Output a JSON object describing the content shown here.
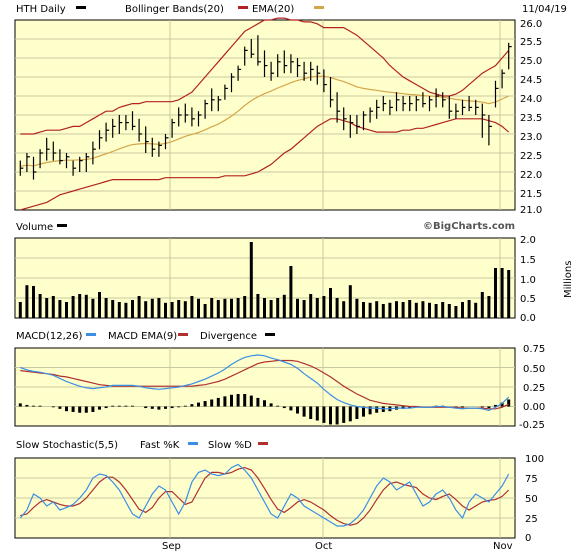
{
  "colors": {
    "panel_bg": "#ffffcc",
    "price_bar": "#000000",
    "bollinger": "#b22222",
    "ema": "#d4a64a",
    "volume_bar": "#000000",
    "macd": "#3a8ee6",
    "macd_ema": "#b03030",
    "fast_k": "#3a8ee6",
    "slow_d": "#b03030"
  },
  "header": {
    "ticker_label": "HTH Daily",
    "bb_label": "Bollinger Bands(20)",
    "ema_label": "EMA(20)",
    "date": "11/04/19"
  },
  "watermark": "©BigCharts.com",
  "chart_data": [
    {
      "type": "ohlc",
      "title": "HTH Daily",
      "legend": [
        "HTH Daily",
        "Bollinger Bands(20)",
        "EMA(20)"
      ],
      "x_tick_labels": [
        "Sep",
        "Oct",
        "Nov"
      ],
      "ylim": [
        21.0,
        26.0
      ],
      "y_ticks": [
        "21.0",
        "21.5",
        "22.0",
        "22.5",
        "23.0",
        "23.5",
        "24.0",
        "24.5",
        "25.0",
        "25.5",
        "26.0"
      ],
      "grid": true,
      "series": [
        {
          "name": "HTH Daily",
          "highs": [
            22.3,
            22.5,
            22.4,
            22.6,
            22.9,
            22.8,
            22.6,
            22.5,
            22.3,
            22.4,
            22.5,
            22.8,
            23.1,
            23.3,
            23.4,
            23.5,
            23.5,
            23.6,
            23.4,
            23.2,
            22.9,
            22.8,
            23.0,
            23.4,
            23.7,
            23.8,
            23.7,
            23.6,
            23.9,
            24.2,
            24.0,
            24.3,
            24.6,
            24.8,
            25.3,
            25.5,
            25.6,
            25.2,
            24.9,
            25.1,
            25.2,
            25.1,
            25.0,
            24.9,
            24.9,
            24.8,
            24.7,
            24.5,
            24.1,
            23.7,
            23.5,
            23.5,
            23.6,
            23.7,
            23.9,
            24.0,
            23.9,
            24.1,
            24.0,
            24.0,
            24.0,
            24.1,
            24.0,
            24.2,
            24.1,
            24.0,
            23.8,
            23.9,
            24.0,
            23.9,
            23.8,
            23.5,
            24.4,
            24.7,
            25.4
          ],
          "lows": [
            21.9,
            22.0,
            21.8,
            22.1,
            22.3,
            22.3,
            22.2,
            22.1,
            21.9,
            22.0,
            22.0,
            22.2,
            22.6,
            22.8,
            22.9,
            23.0,
            23.1,
            23.1,
            22.8,
            22.5,
            22.4,
            22.4,
            22.6,
            22.9,
            23.2,
            23.3,
            23.2,
            23.2,
            23.4,
            23.6,
            23.6,
            23.9,
            24.1,
            24.4,
            24.8,
            25.0,
            24.8,
            24.5,
            24.4,
            24.5,
            24.6,
            24.6,
            24.5,
            24.4,
            24.4,
            24.3,
            24.1,
            23.7,
            23.3,
            23.1,
            22.9,
            23.0,
            23.1,
            23.3,
            23.4,
            23.6,
            23.5,
            23.6,
            23.6,
            23.6,
            23.6,
            23.7,
            23.6,
            23.7,
            23.7,
            23.4,
            23.4,
            23.5,
            23.6,
            23.5,
            22.9,
            22.7,
            23.7,
            24.2,
            24.7
          ],
          "closes": [
            22.1,
            22.4,
            22.0,
            22.5,
            22.6,
            22.5,
            22.3,
            22.4,
            22.1,
            22.3,
            22.4,
            22.6,
            22.9,
            23.1,
            23.2,
            23.3,
            23.3,
            23.2,
            23.0,
            22.8,
            22.6,
            22.7,
            22.9,
            23.3,
            23.5,
            23.5,
            23.4,
            23.5,
            23.8,
            23.9,
            23.9,
            24.2,
            24.5,
            24.7,
            25.2,
            25.1,
            24.9,
            24.8,
            24.6,
            24.9,
            24.8,
            24.9,
            24.8,
            24.6,
            24.7,
            24.6,
            24.3,
            23.9,
            23.6,
            23.4,
            23.3,
            23.2,
            23.5,
            23.6,
            23.7,
            23.8,
            23.7,
            23.9,
            23.8,
            23.8,
            23.9,
            23.8,
            23.9,
            24.0,
            23.9,
            23.6,
            23.6,
            23.7,
            23.7,
            23.7,
            23.5,
            23.2,
            24.2,
            24.6,
            25.3
          ]
        },
        {
          "name": "Bollinger Bands(20)",
          "upper": [
            23.0,
            23.0,
            23.0,
            23.05,
            23.1,
            23.1,
            23.1,
            23.15,
            23.2,
            23.2,
            23.3,
            23.4,
            23.5,
            23.6,
            23.6,
            23.7,
            23.75,
            23.8,
            23.8,
            23.85,
            23.85,
            23.85,
            23.85,
            23.85,
            23.9,
            24.0,
            24.1,
            24.3,
            24.5,
            24.7,
            24.9,
            25.1,
            25.3,
            25.5,
            25.7,
            25.8,
            25.9,
            26.0,
            26.0,
            26.05,
            26.05,
            26.0,
            26.0,
            25.95,
            25.95,
            25.9,
            25.8,
            25.8,
            25.8,
            25.8,
            25.7,
            25.6,
            25.45,
            25.3,
            25.15,
            25.0,
            24.8,
            24.65,
            24.5,
            24.4,
            24.3,
            24.2,
            24.1,
            24.05,
            24.0,
            24.0,
            24.05,
            24.15,
            24.3,
            24.45,
            24.6,
            24.7,
            24.8,
            25.0,
            25.2
          ],
          "lower": [
            21.0,
            21.05,
            21.1,
            21.15,
            21.2,
            21.3,
            21.4,
            21.45,
            21.5,
            21.55,
            21.6,
            21.65,
            21.7,
            21.75,
            21.8,
            21.8,
            21.8,
            21.8,
            21.8,
            21.8,
            21.8,
            21.8,
            21.85,
            21.85,
            21.85,
            21.85,
            21.85,
            21.85,
            21.85,
            21.85,
            21.85,
            21.9,
            21.9,
            21.9,
            21.9,
            21.95,
            22.0,
            22.1,
            22.2,
            22.35,
            22.5,
            22.6,
            22.75,
            22.9,
            23.05,
            23.2,
            23.3,
            23.4,
            23.4,
            23.35,
            23.3,
            23.2,
            23.15,
            23.1,
            23.05,
            23.05,
            23.05,
            23.05,
            23.1,
            23.1,
            23.15,
            23.15,
            23.2,
            23.25,
            23.3,
            23.35,
            23.4,
            23.4,
            23.4,
            23.4,
            23.4,
            23.35,
            23.3,
            23.2,
            23.05
          ]
        },
        {
          "name": "EMA(20)",
          "values": [
            22.15,
            22.18,
            22.16,
            22.21,
            22.25,
            22.28,
            22.3,
            22.31,
            22.31,
            22.32,
            22.33,
            22.36,
            22.42,
            22.48,
            22.54,
            22.61,
            22.67,
            22.72,
            22.74,
            22.75,
            22.74,
            22.73,
            22.75,
            22.8,
            22.87,
            22.94,
            22.99,
            23.04,
            23.11,
            23.19,
            23.26,
            23.36,
            23.47,
            23.6,
            23.75,
            23.88,
            23.98,
            24.06,
            24.13,
            24.21,
            24.28,
            24.35,
            24.41,
            24.45,
            24.5,
            24.52,
            24.52,
            24.49,
            24.43,
            24.38,
            24.31,
            24.24,
            24.2,
            24.17,
            24.15,
            24.12,
            24.1,
            24.08,
            24.06,
            24.04,
            24.03,
            24.01,
            24.0,
            23.99,
            23.97,
            23.94,
            23.91,
            23.89,
            23.87,
            23.86,
            23.84,
            23.8,
            23.84,
            23.92,
            24.0
          ]
        }
      ]
    },
    {
      "type": "bar",
      "title": "Volume",
      "ylabel": "Millions",
      "ylim": [
        0,
        2.0
      ],
      "y_ticks": [
        "0.0",
        "0.5",
        "1.0",
        "1.5",
        "2.0"
      ],
      "values": [
        0.4,
        0.82,
        0.8,
        0.6,
        0.5,
        0.55,
        0.45,
        0.4,
        0.55,
        0.6,
        0.58,
        0.48,
        0.65,
        0.5,
        0.45,
        0.4,
        0.38,
        0.45,
        0.55,
        0.42,
        0.48,
        0.5,
        0.38,
        0.4,
        0.45,
        0.42,
        0.55,
        0.48,
        0.35,
        0.5,
        0.45,
        0.48,
        0.48,
        0.5,
        0.55,
        1.9,
        0.6,
        0.5,
        0.45,
        0.5,
        0.58,
        1.3,
        0.48,
        0.45,
        0.6,
        0.5,
        0.55,
        0.75,
        0.5,
        0.42,
        0.82,
        0.48,
        0.4,
        0.38,
        0.42,
        0.35,
        0.38,
        0.42,
        0.4,
        0.45,
        0.38,
        0.42,
        0.38,
        0.35,
        0.4,
        0.35,
        0.3,
        0.4,
        0.45,
        0.38,
        0.65,
        0.55,
        1.25,
        1.25,
        1.2
      ]
    },
    {
      "type": "line",
      "title": "MACD",
      "legend": [
        "MACD(12,26)",
        "MACD EMA(9)",
        "Divergence"
      ],
      "ylim": [
        -0.25,
        0.75
      ],
      "y_ticks": [
        "-0.25",
        "0.00",
        "0.25",
        "0.50",
        "0.75"
      ],
      "series": [
        {
          "name": "MACD(12,26)",
          "values": [
            0.5,
            0.47,
            0.45,
            0.44,
            0.42,
            0.4,
            0.36,
            0.32,
            0.29,
            0.26,
            0.24,
            0.23,
            0.24,
            0.25,
            0.27,
            0.27,
            0.27,
            0.27,
            0.26,
            0.24,
            0.23,
            0.22,
            0.23,
            0.24,
            0.25,
            0.27,
            0.29,
            0.32,
            0.35,
            0.39,
            0.43,
            0.48,
            0.54,
            0.59,
            0.63,
            0.65,
            0.66,
            0.65,
            0.62,
            0.6,
            0.57,
            0.54,
            0.49,
            0.42,
            0.36,
            0.3,
            0.22,
            0.15,
            0.09,
            0.05,
            0.02,
            0.0,
            -0.01,
            -0.02,
            -0.02,
            -0.03,
            -0.03,
            -0.02,
            -0.02,
            -0.02,
            -0.01,
            -0.01,
            -0.01,
            0.0,
            0.0,
            -0.01,
            -0.02,
            -0.03,
            -0.02,
            -0.02,
            -0.03,
            -0.05,
            -0.01,
            0.04,
            0.12
          ]
        },
        {
          "name": "MACD EMA(9)",
          "values": [
            0.46,
            0.45,
            0.44,
            0.43,
            0.42,
            0.41,
            0.39,
            0.38,
            0.36,
            0.34,
            0.32,
            0.3,
            0.28,
            0.27,
            0.26,
            0.26,
            0.26,
            0.26,
            0.26,
            0.26,
            0.26,
            0.26,
            0.26,
            0.26,
            0.26,
            0.26,
            0.26,
            0.27,
            0.28,
            0.3,
            0.32,
            0.35,
            0.39,
            0.43,
            0.47,
            0.51,
            0.55,
            0.57,
            0.58,
            0.59,
            0.59,
            0.59,
            0.58,
            0.55,
            0.52,
            0.48,
            0.43,
            0.38,
            0.32,
            0.26,
            0.21,
            0.16,
            0.12,
            0.08,
            0.06,
            0.04,
            0.03,
            0.02,
            0.01,
            0.0,
            0.0,
            -0.01,
            -0.01,
            -0.01,
            -0.01,
            -0.01,
            -0.01,
            -0.02,
            -0.02,
            -0.02,
            -0.02,
            -0.03,
            -0.03,
            -0.01,
            0.03
          ]
        },
        {
          "name": "Divergence",
          "values": [
            0.04,
            0.02,
            0.01,
            0.01,
            0.0,
            -0.01,
            -0.03,
            -0.06,
            -0.07,
            -0.08,
            -0.08,
            -0.07,
            -0.04,
            -0.02,
            0.01,
            0.01,
            0.01,
            0.01,
            0.0,
            -0.02,
            -0.03,
            -0.04,
            -0.03,
            -0.02,
            -0.01,
            0.01,
            0.03,
            0.05,
            0.07,
            0.09,
            0.11,
            0.13,
            0.15,
            0.16,
            0.16,
            0.14,
            0.11,
            0.08,
            0.04,
            0.01,
            -0.02,
            -0.05,
            -0.09,
            -0.13,
            -0.16,
            -0.18,
            -0.21,
            -0.23,
            -0.23,
            -0.21,
            -0.19,
            -0.16,
            -0.13,
            -0.1,
            -0.08,
            -0.07,
            -0.06,
            -0.04,
            -0.03,
            -0.02,
            -0.01,
            0.0,
            0.0,
            0.01,
            0.01,
            0.0,
            -0.01,
            -0.01,
            0.0,
            0.0,
            -0.01,
            -0.02,
            0.02,
            0.05,
            0.09
          ]
        }
      ]
    },
    {
      "type": "line",
      "title": "Slow Stochastic",
      "legend": [
        "Slow Stochastic(5,5)",
        "Fast %K",
        "Slow %D"
      ],
      "ylim": [
        0,
        100
      ],
      "y_ticks": [
        "0",
        "25",
        "50",
        "75",
        "100"
      ],
      "series": [
        {
          "name": "Fast %K",
          "values": [
            25,
            35,
            55,
            50,
            40,
            45,
            35,
            38,
            42,
            50,
            60,
            75,
            80,
            78,
            70,
            60,
            45,
            30,
            25,
            40,
            55,
            65,
            60,
            45,
            30,
            45,
            70,
            82,
            85,
            80,
            78,
            80,
            88,
            92,
            85,
            75,
            60,
            45,
            30,
            25,
            40,
            55,
            50,
            40,
            35,
            30,
            25,
            20,
            15,
            15,
            18,
            25,
            35,
            50,
            65,
            75,
            70,
            60,
            65,
            70,
            55,
            40,
            45,
            55,
            60,
            50,
            35,
            25,
            45,
            55,
            50,
            45,
            55,
            65,
            80
          ]
        },
        {
          "name": "Slow %D",
          "values": [
            28,
            30,
            38,
            45,
            48,
            45,
            42,
            40,
            40,
            43,
            50,
            60,
            70,
            76,
            76,
            70,
            60,
            48,
            36,
            32,
            38,
            50,
            58,
            58,
            50,
            42,
            45,
            60,
            75,
            82,
            82,
            80,
            82,
            86,
            88,
            85,
            75,
            62,
            48,
            36,
            32,
            38,
            45,
            48,
            45,
            40,
            35,
            28,
            22,
            18,
            16,
            18,
            25,
            35,
            48,
            60,
            68,
            70,
            67,
            65,
            63,
            55,
            50,
            48,
            52,
            55,
            48,
            40,
            35,
            40,
            45,
            47,
            48,
            52,
            60
          ]
        }
      ]
    }
  ],
  "axis_labels": {
    "price_ticks": [
      "21.0",
      "21.5",
      "22.0",
      "22.5",
      "23.0",
      "23.5",
      "24.0",
      "24.5",
      "25.0",
      "25.5",
      "26.0"
    ],
    "volume_ticks": [
      "0.0",
      "0.5",
      "1.0",
      "1.5",
      "2.0"
    ],
    "volume_unit": "Millions",
    "macd_ticks": [
      "-0.25",
      "0.00",
      "0.25",
      "0.50",
      "0.75"
    ],
    "stoch_ticks": [
      "0",
      "25",
      "50",
      "75",
      "100"
    ],
    "x_ticks": [
      "Sep",
      "Oct",
      "Nov"
    ]
  },
  "volume_legend": "Volume",
  "macd_legend": {
    "macd": "MACD(12,26)",
    "ema": "MACD EMA(9)",
    "div": "Divergence"
  },
  "stoch_legend": {
    "title": "Slow Stochastic(5,5)",
    "fast": "Fast %K",
    "slow": "Slow %D"
  }
}
